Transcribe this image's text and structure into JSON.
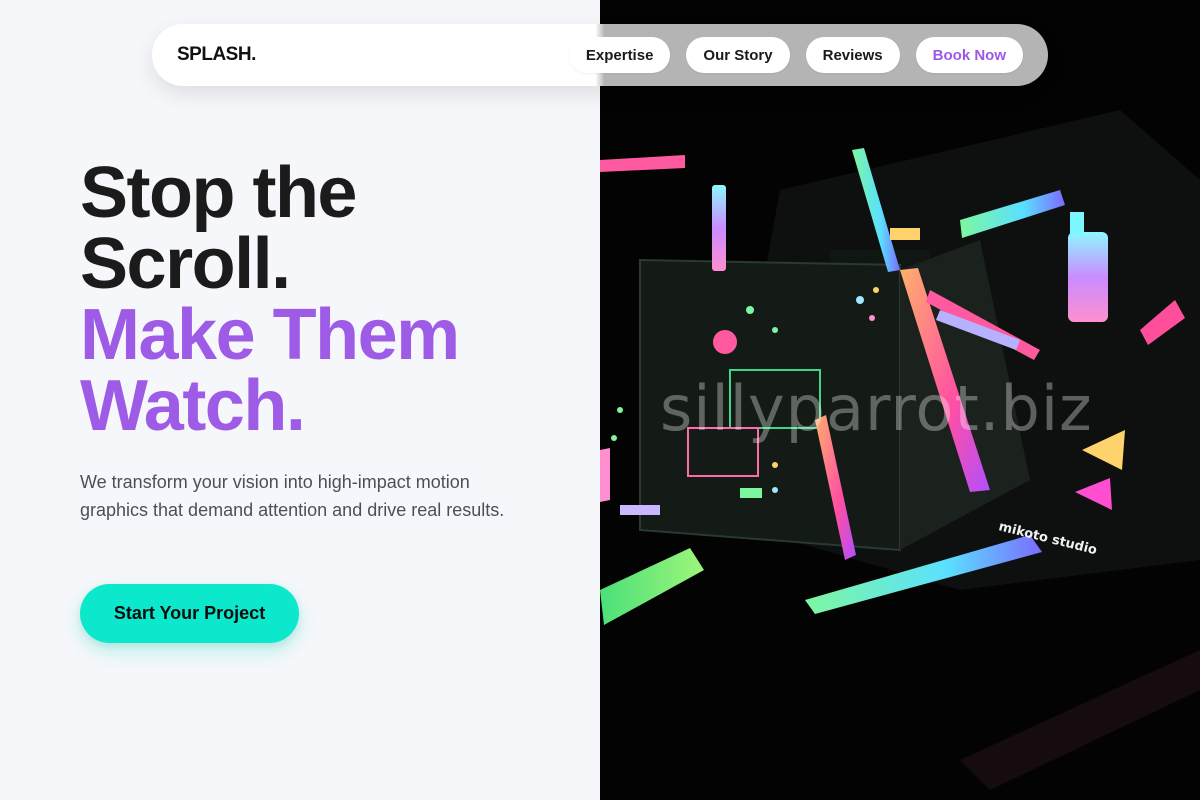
{
  "brand": {
    "logo": "SPLASH."
  },
  "nav": {
    "items": [
      "Expertise",
      "Our Story",
      "Reviews"
    ],
    "cta_label": "Book Now"
  },
  "hero": {
    "headline_line1": "Stop the",
    "headline_line2": "Scroll.",
    "headline_accent1": "Make Them",
    "headline_accent2": "Watch.",
    "subtitle": "We transform your vision into high-impact motion graphics that demand attention and drive real results.",
    "cta_label": "Start Your Project"
  },
  "image": {
    "watermark": "sillyparrot.biz",
    "device_label": "mikoto studio"
  },
  "colors": {
    "accent_purple": "#9d5be6",
    "cta_teal": "#0be8cc",
    "text_dark": "#1b1b1b",
    "background_light": "#f6f7fa",
    "background_dark": "#030303"
  }
}
